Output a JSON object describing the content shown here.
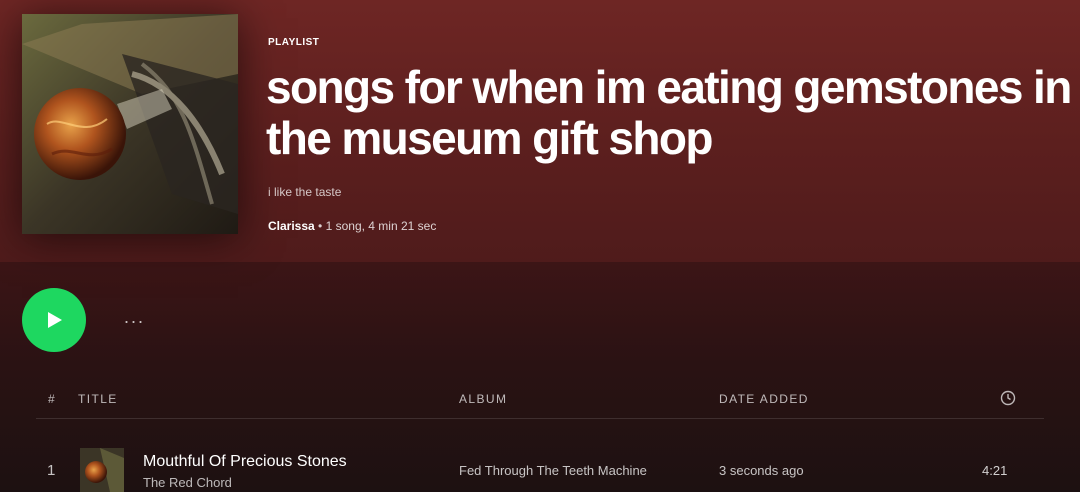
{
  "playlist": {
    "type_label": "PLAYLIST",
    "title": "songs for when im eating gemstones in the museum gift shop",
    "description": "i like the taste",
    "owner": "Clarissa",
    "separator": "•",
    "stats": "1 song, 4 min 21 sec",
    "cover_lettering": "The Red Chord"
  },
  "controls": {
    "play_icon": "play-icon",
    "more_label": "..."
  },
  "table": {
    "headers": {
      "number": "#",
      "title": "TITLE",
      "album": "ALBUM",
      "date_added": "DATE ADDED",
      "duration_icon": "clock-icon"
    },
    "rows": [
      {
        "number": "1",
        "title": "Mouthful Of Precious Stones",
        "artist": "The Red Chord",
        "album": "Fed Through The Teeth Machine",
        "date_added": "3 seconds ago",
        "duration": "4:21"
      }
    ]
  },
  "colors": {
    "accent": "#1ed760",
    "header_bg": "#6e2624",
    "body_bg": "#1a0f10"
  }
}
